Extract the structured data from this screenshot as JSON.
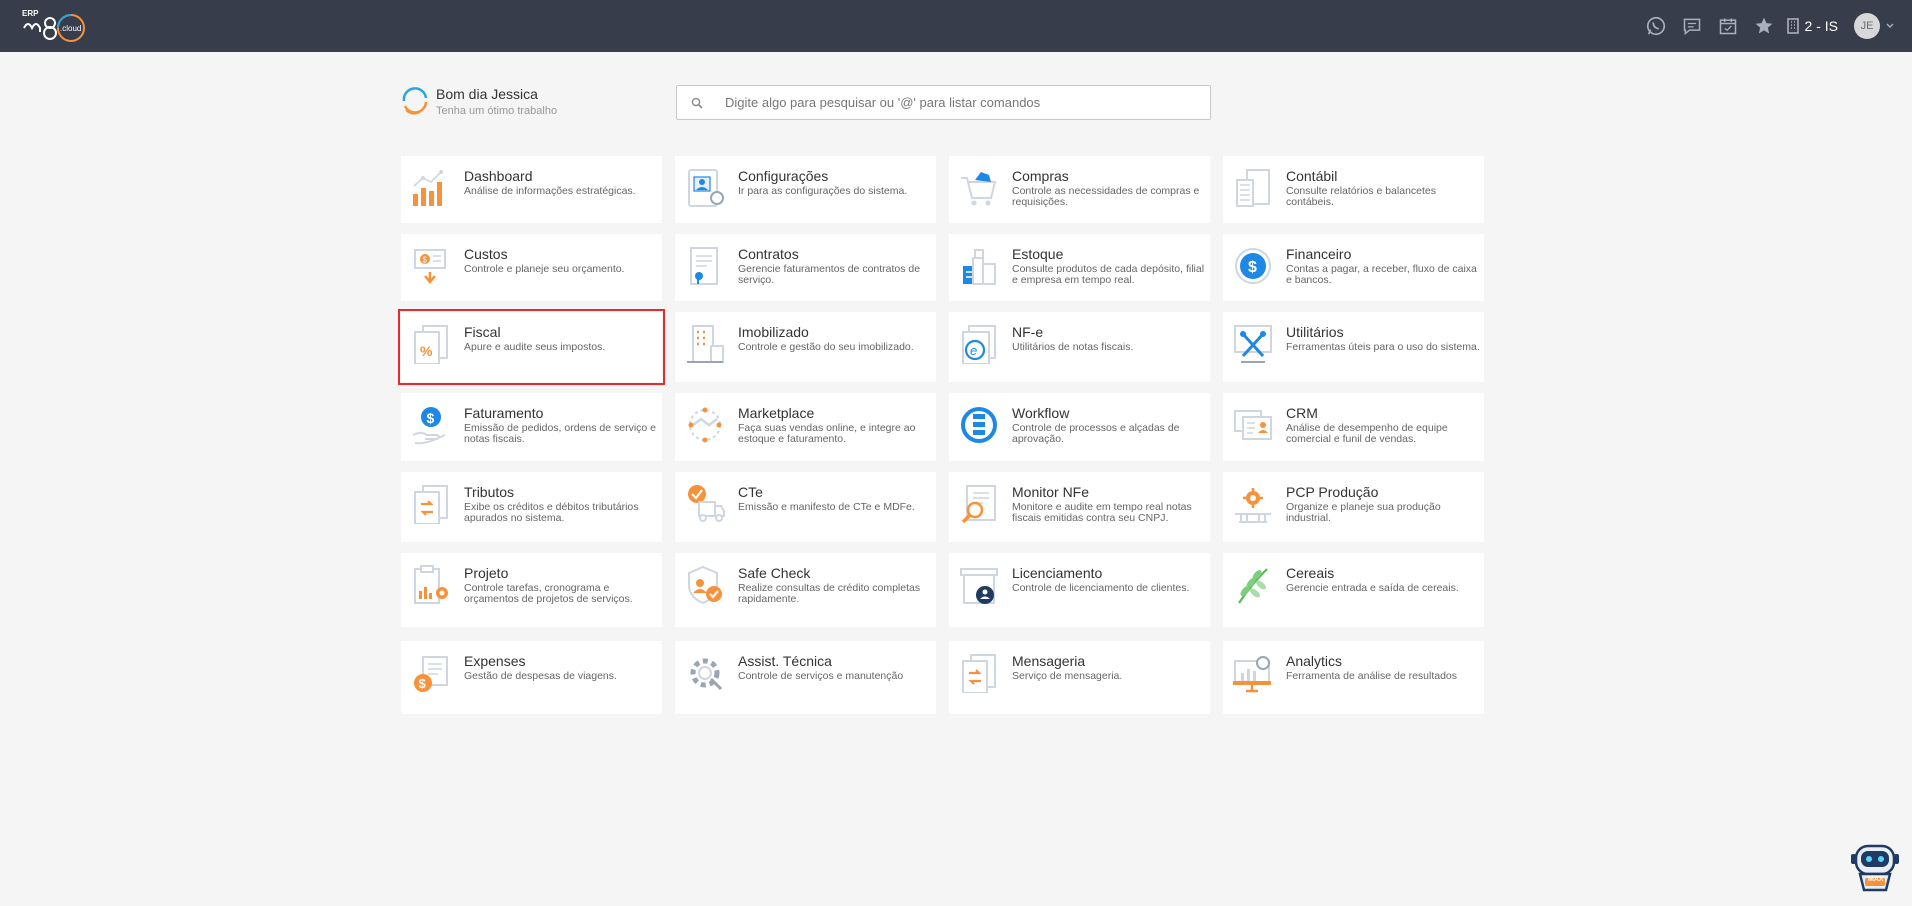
{
  "topbar": {
    "logo_label": "ERP",
    "company_label": "2 - IS",
    "avatar_initials": "JE",
    "icons": [
      "whatsapp-icon",
      "chat-icon",
      "calendar-icon",
      "star-icon",
      "building-icon"
    ]
  },
  "greeting": {
    "title": "Bom dia Jessica",
    "subtitle": "Tenha um ótimo trabalho"
  },
  "search": {
    "placeholder": "Digite algo para pesquisar ou '@' para listar comandos",
    "value": ""
  },
  "modules": [
    {
      "title": "Dashboard",
      "desc": "Análise de informações estratégicas."
    },
    {
      "title": "Configurações",
      "desc": "Ir para as configurações do sistema."
    },
    {
      "title": "Compras",
      "desc": "Controle as necessidades de compras e requisições."
    },
    {
      "title": "Contábil",
      "desc": "Consulte relatórios e balancetes contábeis."
    },
    {
      "title": "Custos",
      "desc": "Controle e planeje seu orçamento."
    },
    {
      "title": "Contratos",
      "desc": "Gerencie faturamentos de contratos de serviço."
    },
    {
      "title": "Estoque",
      "desc": "Consulte produtos de cada depósito, filial e empresa em tempo real."
    },
    {
      "title": "Financeiro",
      "desc": "Contas a pagar, a receber, fluxo de caixa e bancos."
    },
    {
      "title": "Fiscal",
      "desc": "Apure e audite seus impostos."
    },
    {
      "title": "Imobilizado",
      "desc": "Controle e gestão do seu imobilizado."
    },
    {
      "title": "NF-e",
      "desc": "Utilitários de notas fiscais."
    },
    {
      "title": "Utilitários",
      "desc": "Ferramentas úteis para o uso do sistema."
    },
    {
      "title": "Faturamento",
      "desc": "Emissão de pedidos, ordens de serviço e notas fiscais."
    },
    {
      "title": "Marketplace",
      "desc": "Faça suas vendas online, e integre ao estoque e faturamento."
    },
    {
      "title": "Workflow",
      "desc": "Controle de processos e alçadas de aprovação."
    },
    {
      "title": "CRM",
      "desc": "Análise de desempenho de equipe comercial e funil de vendas."
    },
    {
      "title": "Tributos",
      "desc": "Exibe os créditos e débitos tributários apurados no sistema."
    },
    {
      "title": "CTe",
      "desc": "Emissão e manifesto de CTe e MDFe."
    },
    {
      "title": "Monitor NFe",
      "desc": "Monitore e audite em tempo real notas fiscais emitidas contra seu CNPJ."
    },
    {
      "title": "PCP Produção",
      "desc": "Organize e planeje sua produção industrial."
    },
    {
      "title": "Projeto",
      "desc": "Controle tarefas, cronograma e orçamentos de projetos de serviços."
    },
    {
      "title": "Safe Check",
      "desc": "Realize consultas de crédito completas rapidamente."
    },
    {
      "title": "Licenciamento",
      "desc": "Controle de licenciamento de clientes."
    },
    {
      "title": "Cereais",
      "desc": "Gerencie entrada e saída de cereais."
    },
    {
      "title": "Expenses",
      "desc": "Gestão de despesas de viagens."
    },
    {
      "title": "Assist. Técnica",
      "desc": "Controle de serviços e manutenção"
    },
    {
      "title": "Mensageria",
      "desc": "Serviço de mensageria."
    },
    {
      "title": "Analytics",
      "desc": "Ferramenta de análise de resultados"
    }
  ],
  "selected_module": "Fiscal",
  "colors": {
    "topbar": "#373d4b",
    "accent_orange": "#f7923a",
    "accent_blue": "#1e88e5",
    "selection": "#e52b2b"
  },
  "assistant_badge": "MAX"
}
